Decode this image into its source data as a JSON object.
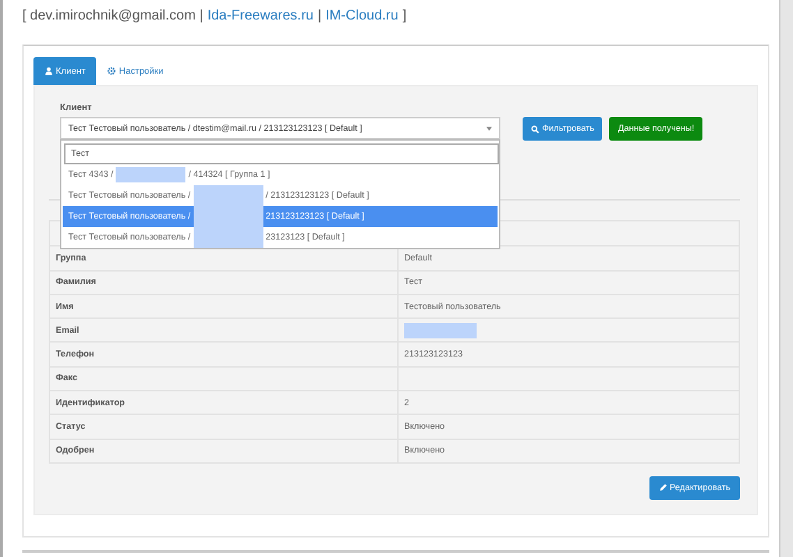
{
  "contact": {
    "parts": [
      {
        "kind": "text",
        "text": "[ dev.imirochnik@gmail.com |"
      },
      {
        "kind": "link",
        "text": "Ida-Freewares.ru"
      },
      {
        "kind": "text",
        "text": "|"
      },
      {
        "kind": "link",
        "text": "IM-Cloud.ru"
      },
      {
        "kind": "text",
        "text": "]"
      }
    ]
  },
  "tabs": [
    {
      "kind": "client",
      "label": "Клиент",
      "selected": true
    },
    {
      "kind": "settings",
      "label": "Настройки",
      "selected": false
    }
  ],
  "client_select": {
    "label": "Клиент",
    "value": "Тест Тестовый пользователь / dtestim@mail.ru / 213123123123 [ Default ]",
    "search": "Тест",
    "options": [
      {
        "before": "Тест 4343 /",
        "redacted": true,
        "after": "/ 414324 [ Группа 1 ]",
        "selected": false
      },
      {
        "before": "Тест Тестовый пользователь /",
        "redacted": true,
        "after": "/ 213123123123 [ Default ]",
        "selected": false
      },
      {
        "before": "Тест Тестовый пользователь /",
        "redacted": true,
        "after": "213123123123 [ Default ]",
        "selected": true
      },
      {
        "before": "Тест Тестовый пользователь /",
        "redacted": true,
        "after": "23123123 [ Default ]",
        "selected": false
      }
    ]
  },
  "buttons": [
    {
      "kind": "primary",
      "label": "Фильтровать"
    },
    {
      "kind": "success",
      "label": "Данные получены!"
    }
  ],
  "details": [
    {
      "label": "Группа",
      "value": "Default"
    },
    {
      "label": "Фамилия",
      "value": "Тест"
    },
    {
      "label": "Имя",
      "value": "Тестовый пользователь"
    },
    {
      "label": "Email",
      "redacted": true
    },
    {
      "label": "Телефон",
      "value": "213123123123"
    },
    {
      "label": "Факс"
    },
    {
      "label": "Идентификатор",
      "value": "2"
    },
    {
      "label": "Статус",
      "value": "Включено"
    },
    {
      "label": "Одобрен",
      "value": "Включено"
    }
  ],
  "edit_button": {
    "label": "Редактировать"
  }
}
